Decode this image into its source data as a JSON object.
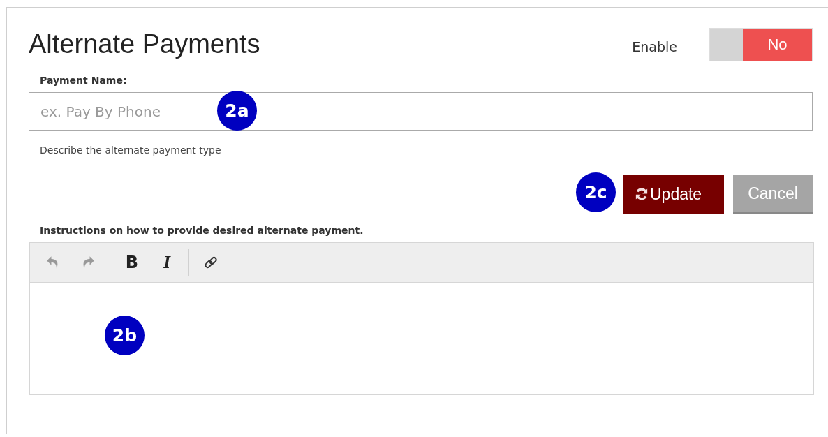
{
  "title": "Alternate Payments",
  "enable": {
    "label": "Enable",
    "on": false,
    "state_text": "No"
  },
  "payment_name": {
    "label": "Payment Name:",
    "placeholder": "ex. Pay By Phone",
    "help": "Describe the alternate payment type",
    "callout": "2a"
  },
  "actions": {
    "callout": "2c",
    "buttons": [
      {
        "label": "Update",
        "kind": "primary"
      },
      {
        "label": "Cancel",
        "kind": "secondary"
      }
    ]
  },
  "instructions": {
    "label": "Instructions on how to provide desired alternate payment.",
    "callout": "2b",
    "toolbar": [
      {
        "kind": "undo",
        "disabled": true
      },
      {
        "kind": "redo",
        "disabled": true
      },
      {
        "kind": "bold",
        "text": "B",
        "disabled": false
      },
      {
        "kind": "italic",
        "text": "I",
        "disabled": false
      },
      {
        "kind": "link",
        "disabled": false
      }
    ]
  }
}
